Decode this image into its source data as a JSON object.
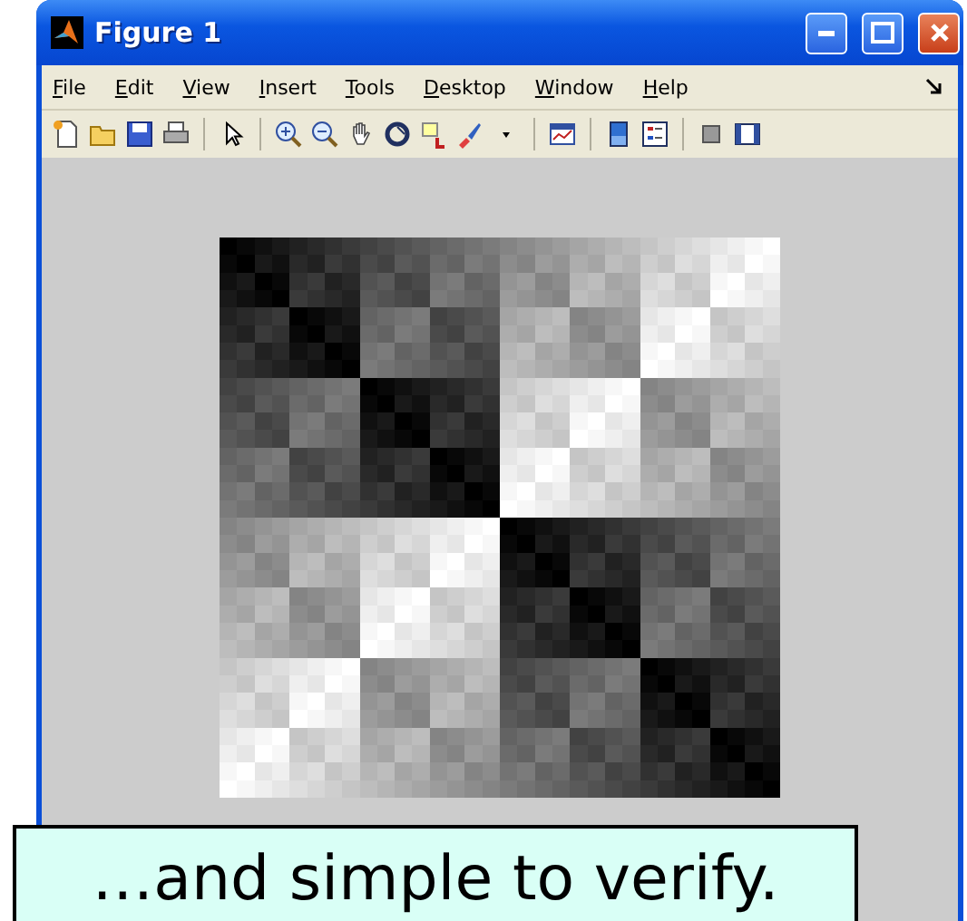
{
  "window": {
    "title": "Figure 1"
  },
  "menu": [
    "File",
    "Edit",
    "View",
    "Insert",
    "Tools",
    "Desktop",
    "Window",
    "Help"
  ],
  "caption": "…and simple to verify."
}
